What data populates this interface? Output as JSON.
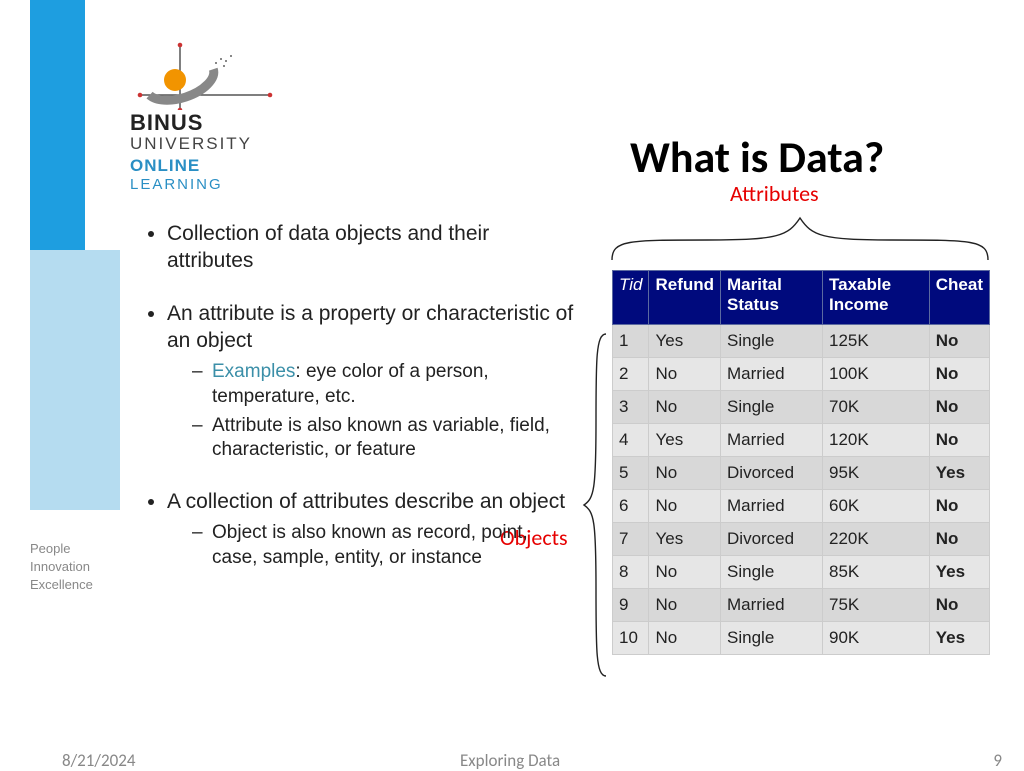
{
  "logo": {
    "line1": "BINUS",
    "line2": "UNIVERSITY",
    "line3": "ONLINE",
    "line4": "LEARNING",
    "tagline1": "People",
    "tagline2": "Innovation",
    "tagline3": "Excellence"
  },
  "title": "What is Data?",
  "labels": {
    "attributes": "Attributes",
    "objects": "Objects"
  },
  "bullets": {
    "b1": "Collection of data objects and their attributes",
    "b2": "An attribute is a property or characteristic of an object",
    "b2s1_examples": "Examples",
    "b2s1_rest": ": eye color of a person, temperature, etc.",
    "b2s2": "Attribute is also known as variable, field, characteristic, or feature",
    "b3": "A collection of attributes describe an object",
    "b3s1": "Object is also known as record, point, case, sample, entity, or instance"
  },
  "table": {
    "headers": {
      "tid": "Tid",
      "refund": "Refund",
      "marital": "Marital Status",
      "income": "Taxable Income",
      "cheat": "Cheat"
    },
    "rows": [
      {
        "tid": "1",
        "refund": "Yes",
        "marital": "Single",
        "income": "125K",
        "cheat": "No"
      },
      {
        "tid": "2",
        "refund": "No",
        "marital": "Married",
        "income": "100K",
        "cheat": "No"
      },
      {
        "tid": "3",
        "refund": "No",
        "marital": "Single",
        "income": "70K",
        "cheat": "No"
      },
      {
        "tid": "4",
        "refund": "Yes",
        "marital": "Married",
        "income": "120K",
        "cheat": "No"
      },
      {
        "tid": "5",
        "refund": "No",
        "marital": "Divorced",
        "income": "95K",
        "cheat": "Yes"
      },
      {
        "tid": "6",
        "refund": "No",
        "marital": "Married",
        "income": "60K",
        "cheat": "No"
      },
      {
        "tid": "7",
        "refund": "Yes",
        "marital": "Divorced",
        "income": "220K",
        "cheat": "No"
      },
      {
        "tid": "8",
        "refund": "No",
        "marital": "Single",
        "income": "85K",
        "cheat": "Yes"
      },
      {
        "tid": "9",
        "refund": "No",
        "marital": "Married",
        "income": "75K",
        "cheat": "No"
      },
      {
        "tid": "10",
        "refund": "No",
        "marital": "Single",
        "income": "90K",
        "cheat": "Yes"
      }
    ]
  },
  "footer": {
    "date": "8/21/2024",
    "subject": "Exploring Data",
    "page": "9"
  },
  "chart_data": {
    "type": "table",
    "title": "What is Data?",
    "columns": [
      "Tid",
      "Refund",
      "Marital Status",
      "Taxable Income",
      "Cheat"
    ],
    "rows": [
      [
        1,
        "Yes",
        "Single",
        "125K",
        "No"
      ],
      [
        2,
        "No",
        "Married",
        "100K",
        "No"
      ],
      [
        3,
        "No",
        "Single",
        "70K",
        "No"
      ],
      [
        4,
        "Yes",
        "Married",
        "120K",
        "No"
      ],
      [
        5,
        "No",
        "Divorced",
        "95K",
        "Yes"
      ],
      [
        6,
        "No",
        "Married",
        "60K",
        "No"
      ],
      [
        7,
        "Yes",
        "Divorced",
        "220K",
        "No"
      ],
      [
        8,
        "No",
        "Single",
        "85K",
        "Yes"
      ],
      [
        9,
        "No",
        "Married",
        "75K",
        "No"
      ],
      [
        10,
        "No",
        "Single",
        "90K",
        "Yes"
      ]
    ]
  }
}
